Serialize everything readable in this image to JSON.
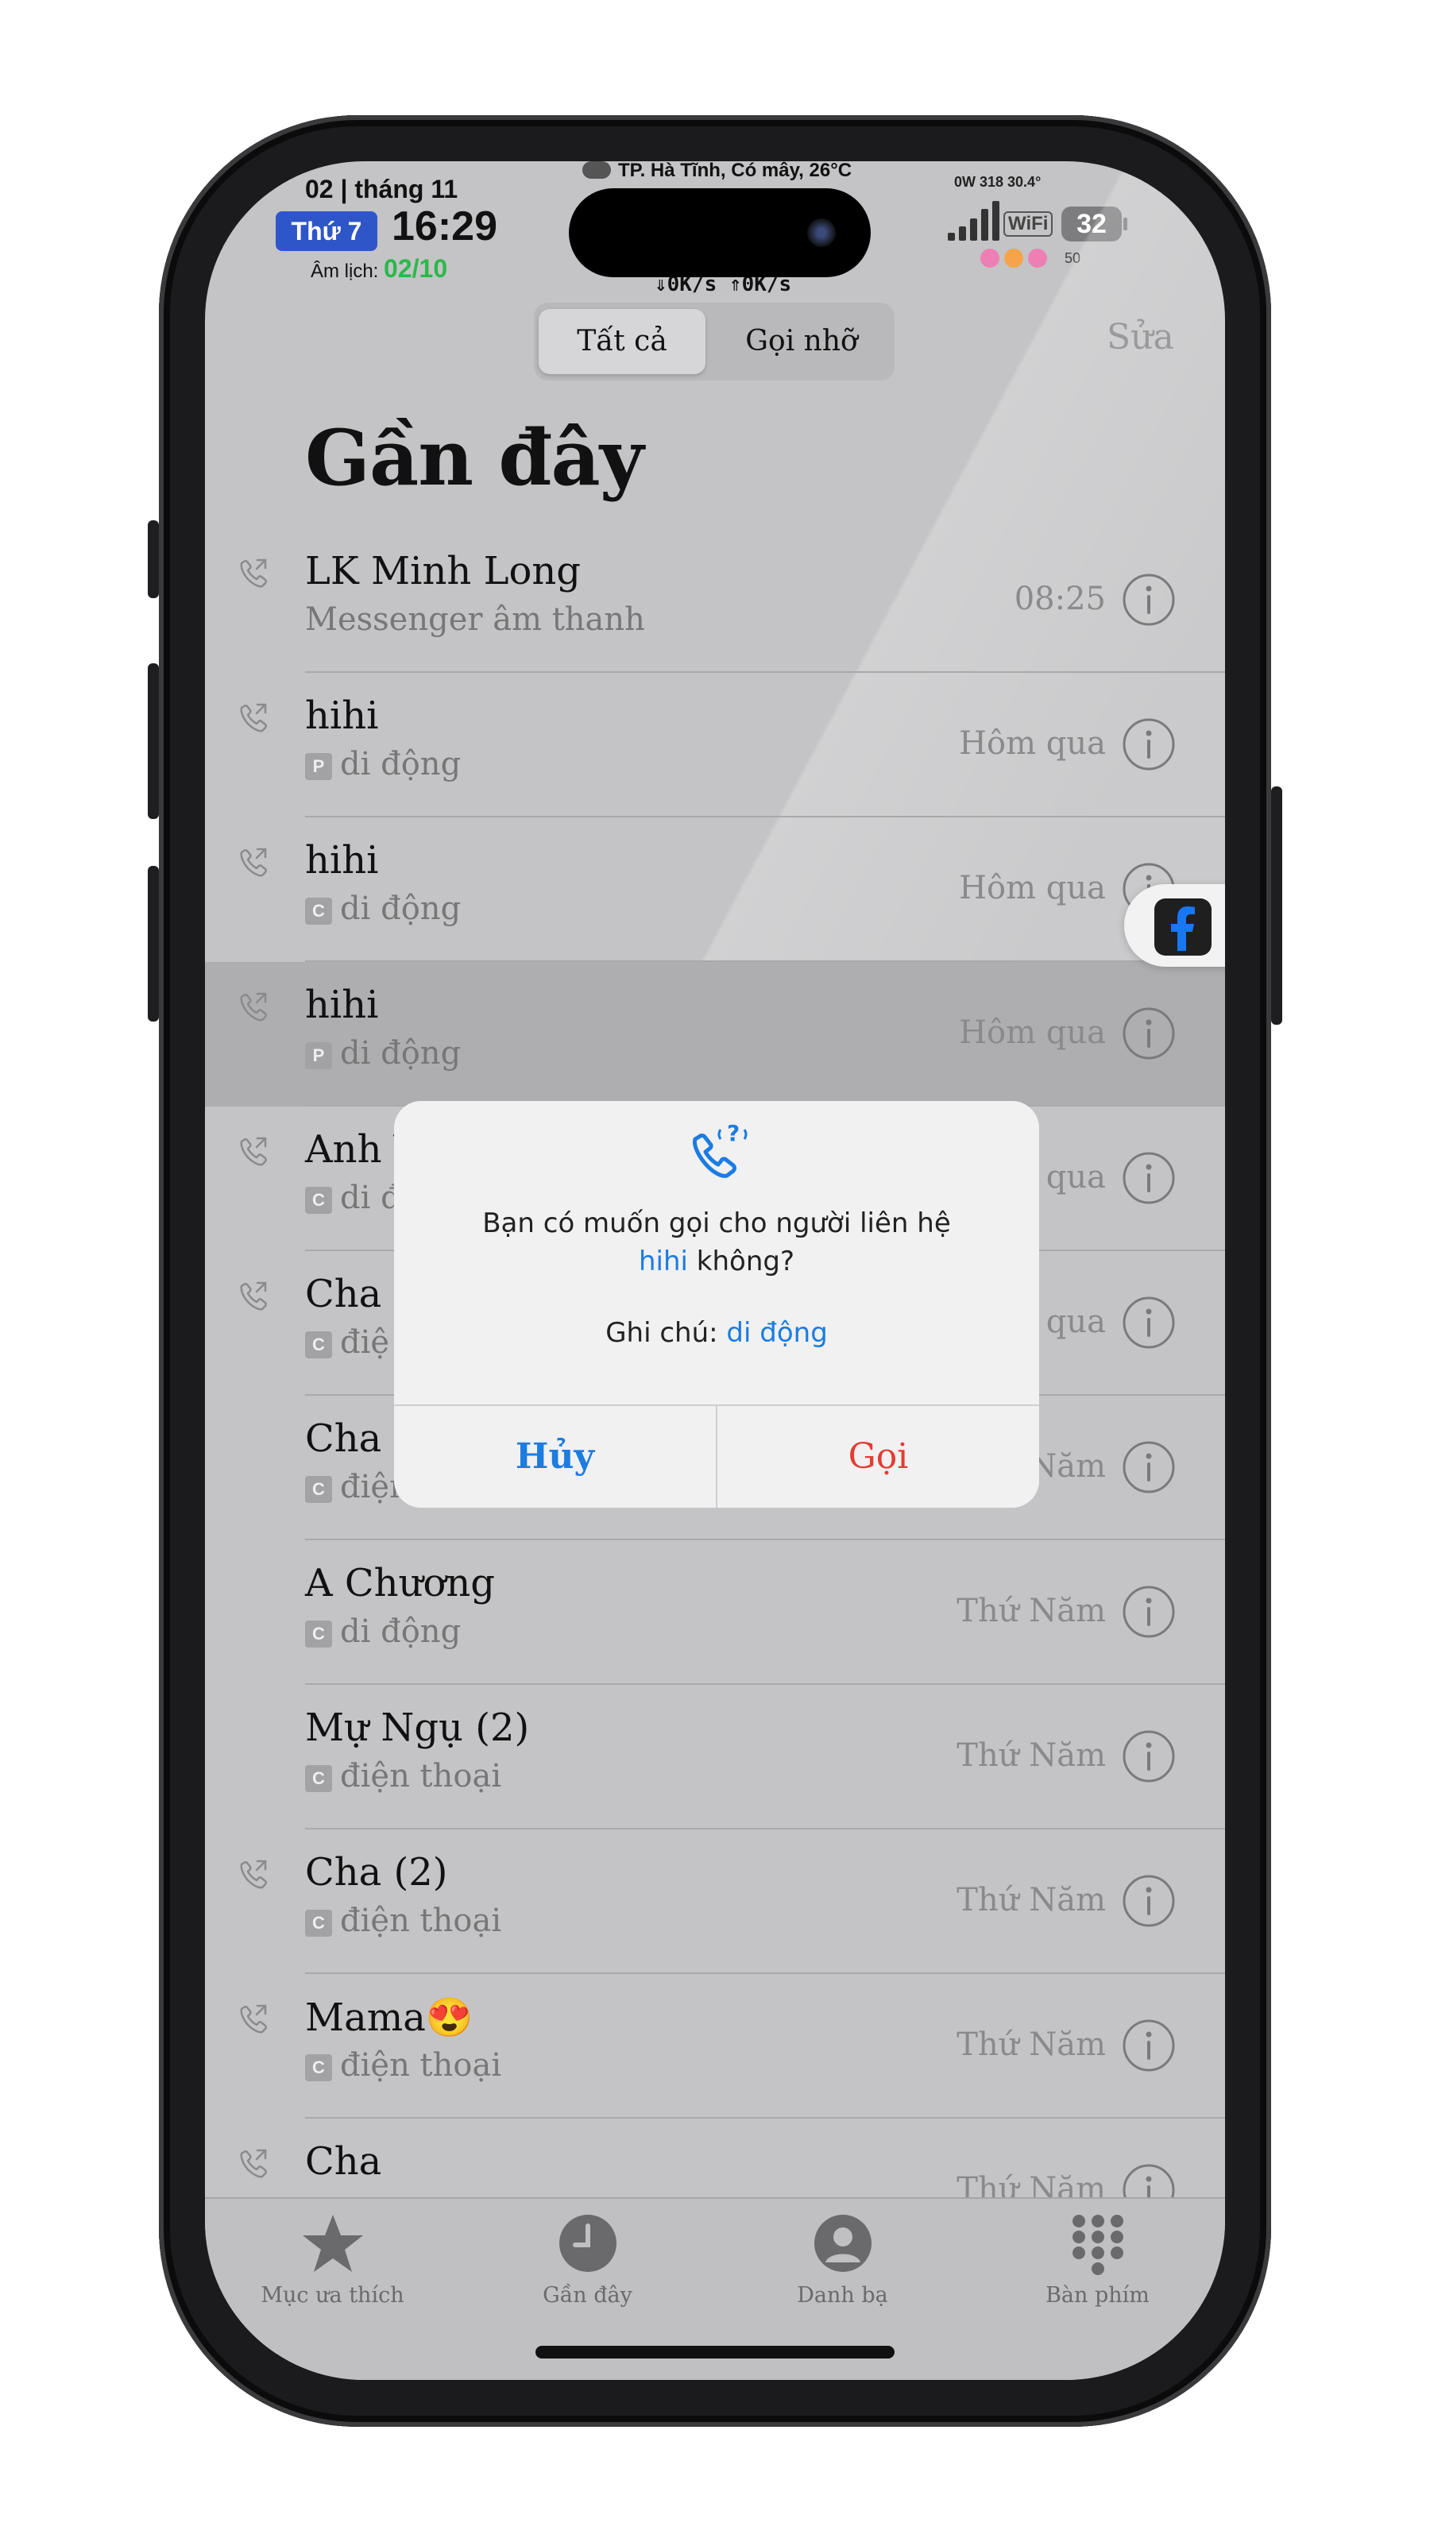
{
  "status_bar": {
    "date": "02 | tháng 11",
    "weekday": "Thứ 7",
    "time": "16:29",
    "lunar_label": "Âm lịch:",
    "lunar_date": "02/10",
    "weather": "TP. Hà Tĩnh, Có mây, 26°C",
    "net_speed": "⇓0K/s ⇑0K/s",
    "power_stats": "0W  318  30.4°",
    "wifi_label": "WiFi",
    "battery": "32",
    "volume": "50"
  },
  "header": {
    "tabs": [
      "Tất cả",
      "Gọi nhỡ"
    ],
    "selected_tab": "Tất cả",
    "edit_label": "Sửa",
    "title": "Gần đây"
  },
  "calls": [
    {
      "name": "LK Minh Long",
      "badge": "",
      "type": "Messenger âm thanh",
      "time": "08:25",
      "outgoing": true
    },
    {
      "name": "hihi",
      "badge": "P",
      "type": "di động",
      "time": "Hôm qua",
      "outgoing": true
    },
    {
      "name": "hihi",
      "badge": "C",
      "type": "di động",
      "time": "Hôm qua",
      "outgoing": true
    },
    {
      "name": "hihi",
      "badge": "P",
      "type": "di động",
      "time": "Hôm qua",
      "outgoing": true,
      "selected": true
    },
    {
      "name": "Anh Y",
      "badge": "C",
      "type": "di đ",
      "time": "qua",
      "outgoing": true
    },
    {
      "name": "Cha (",
      "badge": "C",
      "type": "điệ",
      "time": "qua",
      "outgoing": true
    },
    {
      "name": "Cha",
      "badge": "C",
      "type": "điện thoại",
      "time": "Năm",
      "outgoing": false
    },
    {
      "name": "A Chương",
      "badge": "C",
      "type": "di động",
      "time": "Thứ Năm",
      "outgoing": false
    },
    {
      "name": "Mự Ngụ (2)",
      "badge": "C",
      "type": "điện thoại",
      "time": "Thứ Năm",
      "outgoing": false
    },
    {
      "name": "Cha (2)",
      "badge": "C",
      "type": "điện thoại",
      "time": "Thứ Năm",
      "outgoing": true
    },
    {
      "name": "Mama😍",
      "badge": "C",
      "type": "điện thoại",
      "time": "Thứ Năm",
      "outgoing": true
    },
    {
      "name": "Cha",
      "badge": "",
      "type": "",
      "time": "Thứ Năm",
      "outgoing": true
    }
  ],
  "alert": {
    "message_before": "Bạn có muốn gọi cho người liên hệ",
    "contact": "hihi",
    "message_after": "không?",
    "note_label": "Ghi chú:",
    "note_value": "di động",
    "cancel_label": "Hủy",
    "call_label": "Gọi"
  },
  "floating_app": {
    "icon": "facebook-icon"
  },
  "tab_bar": [
    {
      "label": "Mục ưa thích",
      "icon": "star-icon"
    },
    {
      "label": "Gần đây",
      "icon": "clock-icon"
    },
    {
      "label": "Danh bạ",
      "icon": "person-icon"
    },
    {
      "label": "Bàn phím",
      "icon": "keypad-icon"
    }
  ],
  "colors": {
    "accent_blue": "#1c7ce0",
    "destructive_red": "#e23d33",
    "weekday_badge": "#2f56c9",
    "lunar_green": "#2bb84a"
  }
}
